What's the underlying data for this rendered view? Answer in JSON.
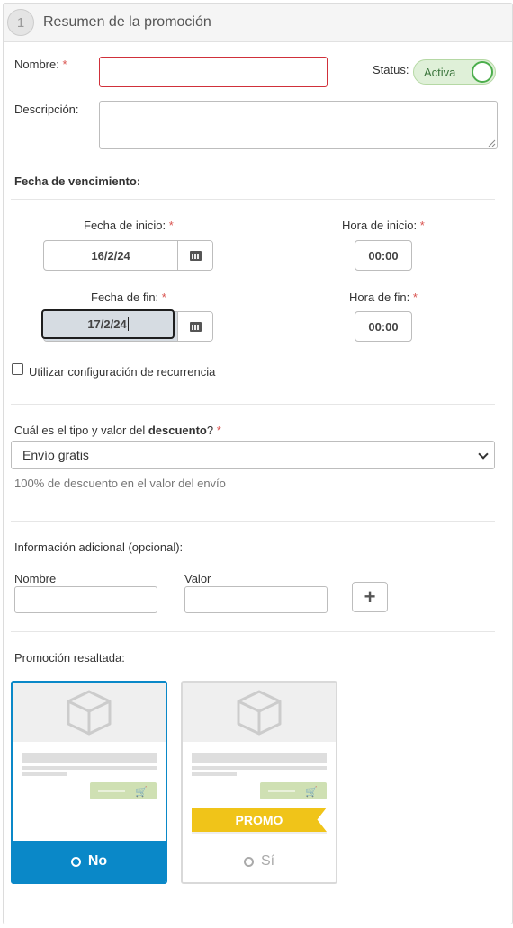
{
  "header": {
    "step": "1",
    "title": "Resumen de la promoción"
  },
  "form": {
    "name_label": "Nombre:",
    "required_mark": "*",
    "name_value": "",
    "status_label": "Status:",
    "status_value": "Activa",
    "description_label": "Descripción:",
    "description_value": ""
  },
  "expiry": {
    "title": "Fecha de vencimiento:",
    "start_date_label": "Fecha de inicio:",
    "start_date_value": "16/2/24",
    "start_time_label": "Hora de inicio:",
    "start_time_value": "00:00",
    "end_date_label": "Fecha de fin:",
    "end_date_value": "17/2/24",
    "end_time_label": "Hora de fin:",
    "end_time_value": "00:00",
    "recurrence_label": "Utilizar configuración de recurrencia",
    "recurrence_checked": false
  },
  "discount": {
    "label_prefix": "Cuál es el tipo y valor del ",
    "label_bold": "descuento",
    "label_suffix": "?",
    "selected": "Envío gratis",
    "help": "100% de descuento en el valor del envío"
  },
  "additional": {
    "title": "Información adicional (opcional):",
    "name_label": "Nombre",
    "value_label": "Valor",
    "add_symbol": "+"
  },
  "highlight": {
    "title": "Promoción resaltada:",
    "options": [
      {
        "label": "No",
        "selected": true
      },
      {
        "label": "Sí",
        "selected": false
      }
    ],
    "promo_badge": "PROMO"
  },
  "colors": {
    "accent": "#0a88c8",
    "toggle_bg": "#dff0d8",
    "promo": "#f0c419",
    "required": "#d9534f"
  }
}
